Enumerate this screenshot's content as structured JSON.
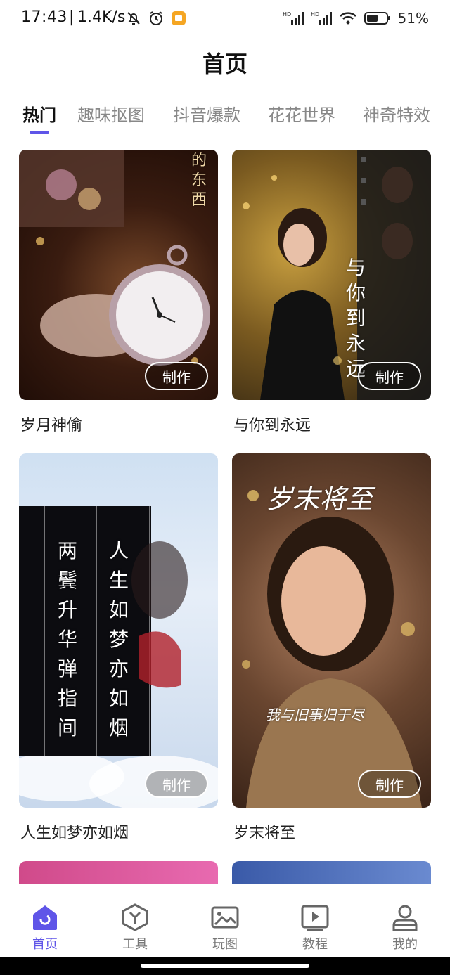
{
  "status_bar": {
    "time": "17:43",
    "speed": "1.4K/s",
    "battery": "51%",
    "left_icons": [
      "bell-off-icon",
      "alarm-icon",
      "app-notification-icon"
    ],
    "right_icons": [
      "hd-signal-icon",
      "hd-signal-icon",
      "wifi-icon",
      "battery-icon"
    ]
  },
  "header": {
    "title": "首页"
  },
  "tabs": [
    {
      "label": "热门",
      "active": true
    },
    {
      "label": "趣味抠图"
    },
    {
      "label": "抖音爆款"
    },
    {
      "label": "花花世界"
    },
    {
      "label": "神奇特效"
    }
  ],
  "cards": [
    {
      "title": "岁月神偷",
      "button": "制作",
      "overlay": "的东西"
    },
    {
      "title": "与你到永远",
      "button": "制作",
      "overlay": "与你到永远"
    },
    {
      "title": "人生如梦亦如烟",
      "button": "制作",
      "overlay_a": "两鬓升华弹指间",
      "overlay_b": "人生如梦亦如烟"
    },
    {
      "title": "岁末将至",
      "button": "制作",
      "overlay": "岁末将至",
      "overlay_sub": "我与旧事归于尽"
    }
  ],
  "bottom_nav": [
    {
      "label": "首页",
      "icon": "home-icon",
      "active": true
    },
    {
      "label": "工具",
      "icon": "toolbox-icon"
    },
    {
      "label": "玩图",
      "icon": "image-icon"
    },
    {
      "label": "教程",
      "icon": "play-video-icon"
    },
    {
      "label": "我的",
      "icon": "user-icon"
    }
  ],
  "colors": {
    "accent": "#5f55e8",
    "text": "#222222",
    "muted": "#888888"
  }
}
